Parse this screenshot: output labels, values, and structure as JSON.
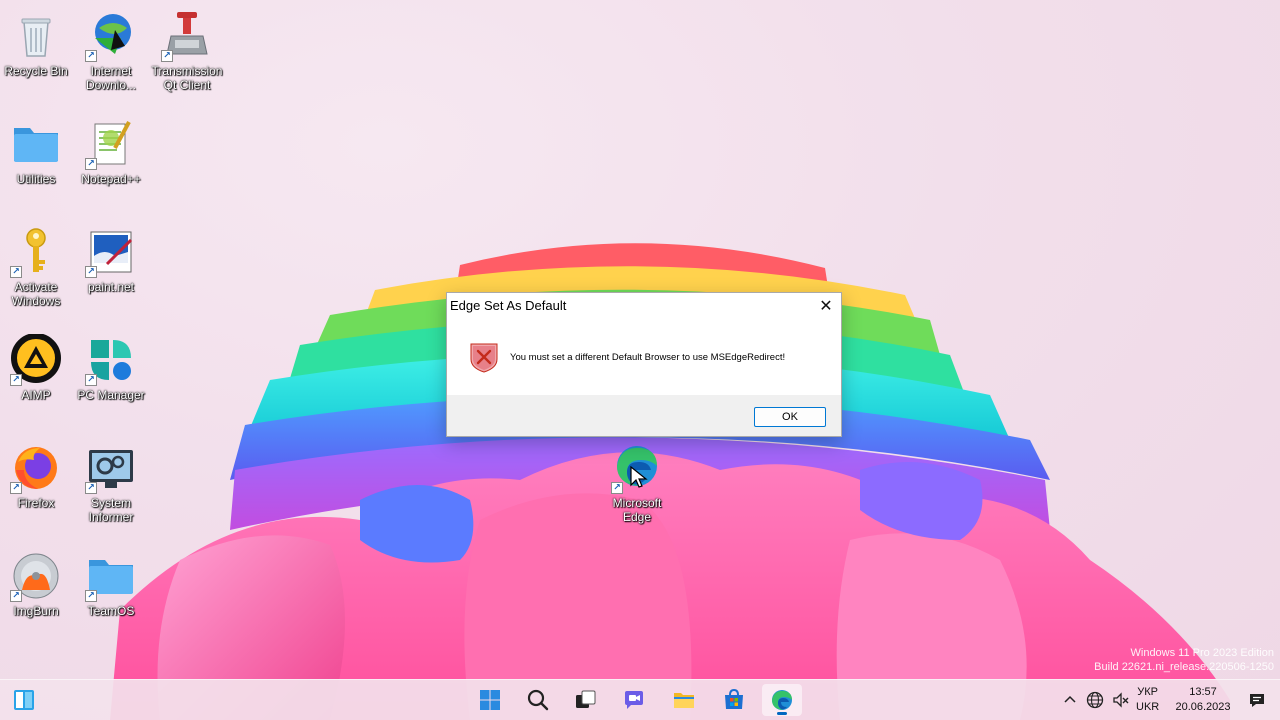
{
  "desktop_icons": [
    {
      "id": "recycle-bin",
      "label": "Recycle Bin",
      "icon": "recycle-bin-icon"
    },
    {
      "id": "internet-download-manager",
      "label": "Internet Downlo...",
      "icon": "internet-download-manager-icon"
    },
    {
      "id": "transmission",
      "label": "Transmission Qt Client",
      "icon": "transmission-icon"
    },
    {
      "id": "utilities",
      "label": "Utilities",
      "icon": "folder-icon"
    },
    {
      "id": "notepad-plus-plus",
      "label": "Notepad++",
      "icon": "notepad-plus-plus-icon"
    },
    {
      "id": "activate-windows",
      "label": "Activate Windows",
      "icon": "key-icon"
    },
    {
      "id": "paint-net",
      "label": "paint.net",
      "icon": "paint-net-icon"
    },
    {
      "id": "aimp",
      "label": "AIMP",
      "icon": "aimp-icon"
    },
    {
      "id": "pc-manager",
      "label": "PC Manager",
      "icon": "pc-manager-icon"
    },
    {
      "id": "firefox",
      "label": "Firefox",
      "icon": "firefox-icon"
    },
    {
      "id": "system-informer",
      "label": "System Informer",
      "icon": "system-informer-icon"
    },
    {
      "id": "microsoft-edge",
      "label": "Microsoft Edge",
      "icon": "edge-icon"
    },
    {
      "id": "imgburn",
      "label": "ImgBurn",
      "icon": "imgburn-icon"
    },
    {
      "id": "teamos",
      "label": "TeamOS",
      "icon": "folder-icon"
    }
  ],
  "dialog": {
    "title": "Edge Set As Default",
    "close_symbol": "✕",
    "message": "You must set a different Default Browser to use MSEdgeRedirect!",
    "ok_label": "OK",
    "icon": "error-shield-icon"
  },
  "watermark": {
    "line1": "Windows 11 Pro 2023 Edition",
    "line2": "Build 22621.ni_release.220506-1250"
  },
  "taskbar": {
    "pinned": [
      "widgets-icon",
      "start-icon",
      "search-icon",
      "task-view-icon",
      "teams-chat-icon",
      "file-explorer-icon",
      "microsoft-store-icon",
      "edge-icon"
    ],
    "tray": {
      "lang_top": "УКР",
      "lang_bottom": "UKR",
      "time": "13:57",
      "date": "20.06.2023"
    }
  },
  "colors": {
    "accent": "#0078d4",
    "dialog_footer": "#f0f0f0",
    "error_red": "#c42b1c"
  }
}
